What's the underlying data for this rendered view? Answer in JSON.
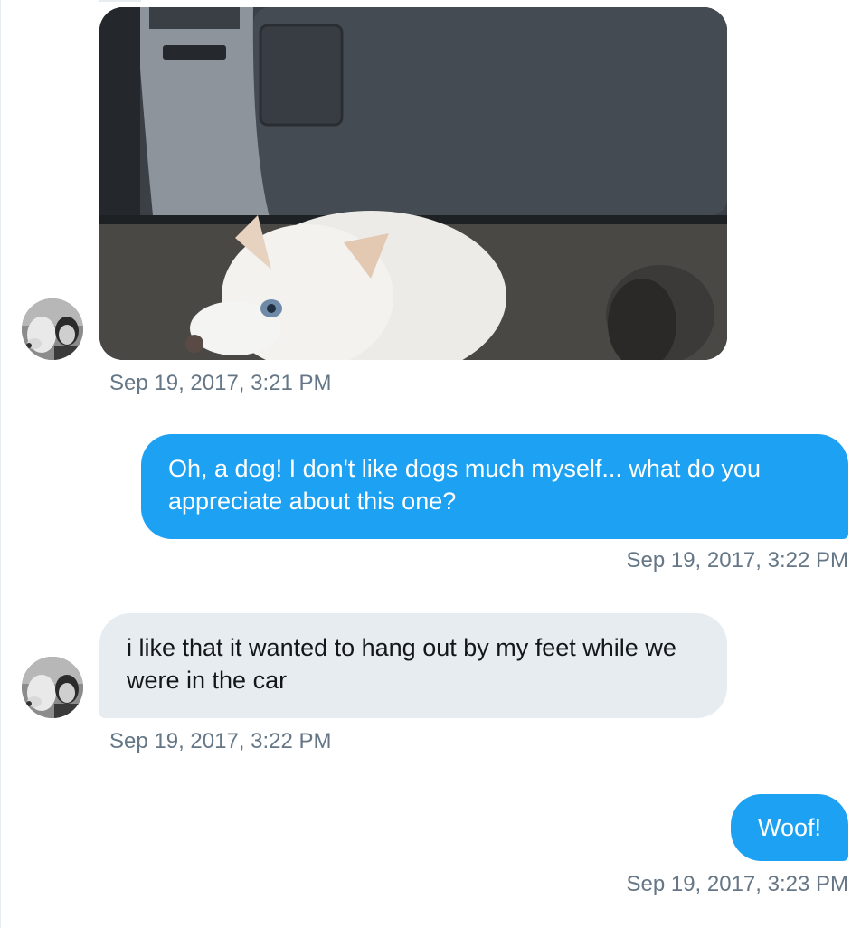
{
  "conversation": {
    "messages": [
      {
        "type": "photo",
        "direction": "received",
        "image_description": "white dog under car dashboard",
        "timestamp": "Sep 19, 2017, 3:21 PM"
      },
      {
        "type": "text",
        "direction": "sent",
        "text": "Oh, a dog! I don't like dogs much myself... what do you appreciate about this one?",
        "timestamp": "Sep 19, 2017, 3:22 PM"
      },
      {
        "type": "text",
        "direction": "received",
        "text": "i like that it wanted to hang out by my feet while we were in the car",
        "timestamp": "Sep 19, 2017, 3:22 PM"
      },
      {
        "type": "text",
        "direction": "sent",
        "text": "Woof!",
        "timestamp": "Sep 19, 2017, 3:23 PM"
      }
    ]
  },
  "colors": {
    "sent_bubble": "#1da1f2",
    "received_bubble": "#e6ecf0",
    "timestamp_text": "#657786"
  },
  "icons": {
    "avatar": "user-avatar-icon"
  }
}
